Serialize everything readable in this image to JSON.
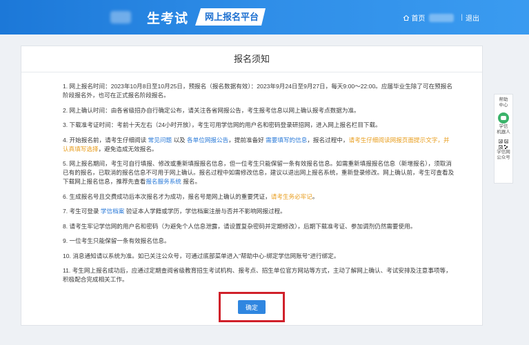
{
  "header": {
    "title": "生考试",
    "badge": "网上报名平台",
    "home": "首页",
    "logout": "退出",
    "separator": "|"
  },
  "card": {
    "title": "报名须知",
    "items": [
      {
        "parts": [
          {
            "t": "1. 网上报名时间：2023年10月8日至10月25日，预报名（报名数据有效）：2023年9月24日至9月27日，每天9:00～22:00。应届毕业生除了可在预报名阶段报名外，也可在正式报名阶段报名。"
          }
        ]
      },
      {
        "parts": [
          {
            "t": "2. 网上确认时间：由各省级招办自行确定公布，请关注各省网报公告，考生报考信息以网上确认报考点数据为准。"
          }
        ]
      },
      {
        "parts": [
          {
            "t": "3. 下载准考证时间：考前十天左右（24小时开放），考生可用学信网的用户名和密码登录研招网，进入网上报名栏目下载。"
          }
        ]
      },
      {
        "parts": [
          {
            "t": "4. 开始报名前，请考生仔细阅读 "
          },
          {
            "t": "常见问题",
            "c": "link"
          },
          {
            "t": " 以及 "
          },
          {
            "t": "各单位网报公告",
            "c": "link"
          },
          {
            "t": "，提前准备好 "
          },
          {
            "t": "需要填写的信息",
            "c": "link"
          },
          {
            "t": "，报名过程中，"
          },
          {
            "t": "请考生仔细阅读网报页面提示文字，并认真填写选择",
            "c": "warn"
          },
          {
            "t": "，避免造成无效报名。"
          }
        ]
      },
      {
        "parts": [
          {
            "t": "5. 网上报名期间，考生可自行填报、修改或重新填报报名信息，但一位考生只能保留一条有效报名信息。如需重新填报报名信息（新增报名），须取消已有的报名，已取消的报名信息不可用于网上确认。报名过程中如需修改信息，建议以退出网上报名系统，重新登录修改。网上确认前，考生可查看及下载网上报名信息，推荐先查看"
          },
          {
            "t": "报名服务系统",
            "c": "link"
          },
          {
            "t": " 报名。"
          }
        ]
      },
      {
        "parts": [
          {
            "t": "6. 生成报名号且交费成功后本次报名才为成功，报名号是网上确认的重要凭证，"
          },
          {
            "t": "请考生务必牢记",
            "c": "warn"
          },
          {
            "t": "。"
          }
        ]
      },
      {
        "parts": [
          {
            "t": "7. 考生可登录 "
          },
          {
            "t": "学信档案",
            "c": "link"
          },
          {
            "t": " 验证本人学籍或学历，学信档案注册与否并不影响网报过程。"
          }
        ]
      },
      {
        "parts": [
          {
            "t": "8. 请考生牢记学信网的用户名和密码（为避免个人信息泄露，请设置复杂密码并定期修改），后期下载准考证、参加调剂仍然需要使用。"
          }
        ]
      },
      {
        "parts": [
          {
            "t": "9. 一位考生只能保留一条有效报名信息。"
          }
        ]
      },
      {
        "parts": [
          {
            "t": "10. 消息通知请以系统为准。如已关注公众号，可通过底部菜单进入\"帮助中心-绑定学信网账号\"进行绑定。"
          }
        ]
      },
      {
        "parts": [
          {
            "t": "11. 考生网上报名成功后，应通过定期查阅省级教育招生考试机构、报考点、招生单位官方网站等方式，主动了解网上确认、考试安排及注意事项等，积极配合完成相关工作。"
          }
        ]
      }
    ],
    "confirm_label": "确定"
  },
  "side_panel": {
    "help": "帮助\n中心",
    "robot": "学信\n机器人",
    "qr": "学信网\n公众号"
  },
  "colors": {
    "header_blue": "#2f8ee8",
    "link": "#2a7ad8",
    "warn": "#e89d1c",
    "highlight_box": "#d0202a",
    "button": "#2f86e0"
  }
}
